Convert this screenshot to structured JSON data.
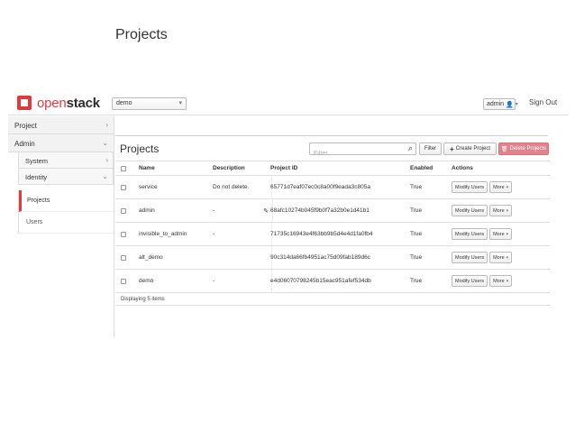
{
  "brand": {
    "part1": "open",
    "part2": "stack"
  },
  "topbar": {
    "project_selector": "demo",
    "user": "admin",
    "signout": "Sign Out"
  },
  "sidebar": {
    "sections": [
      {
        "label": "Project"
      },
      {
        "label": "Admin"
      }
    ],
    "admin_subsections": [
      {
        "label": "System"
      },
      {
        "label": "Identity"
      }
    ],
    "items": [
      {
        "label": "Projects",
        "active": true
      },
      {
        "label": "Users",
        "active": false
      }
    ]
  },
  "main": {
    "page_title": "Projects",
    "table_title": "Projects",
    "filter_placeholder": "Filter",
    "filter_button": "Filter",
    "create_button": "Create Project",
    "delete_button": "Delete Projects",
    "columns": [
      "Name",
      "Description",
      "Project ID",
      "Enabled",
      "Actions"
    ],
    "rows": [
      {
        "name": "service",
        "description": "Do not delete.",
        "id": "65771d7eaf07ec0c8a00f9eada3c805a",
        "enabled": "True",
        "edit": false
      },
      {
        "name": "admin",
        "description": "-",
        "id": "68afc10274b045f9b0f7a32b0e1d41b1",
        "enabled": "True",
        "edit": true
      },
      {
        "name": "invisible_to_admin",
        "description": "-",
        "id": "71735c16943e4f63bb9b5d4e4d1fa0fb4",
        "enabled": "True",
        "edit": false
      },
      {
        "name": "alt_demo",
        "description": "",
        "id": "90c314da66fb4951ac75d09fab189d6c",
        "enabled": "True",
        "edit": false
      },
      {
        "name": "demo",
        "description": "-",
        "id": "e4d06070798245b15eac951afef534db",
        "enabled": "True",
        "edit": false
      }
    ],
    "row_action_primary": "Modify Users",
    "row_action_more": "More",
    "footer": "Displaying 5 items"
  },
  "colors": {
    "accent": "#e03a3e",
    "danger_button": "#e0838a"
  }
}
